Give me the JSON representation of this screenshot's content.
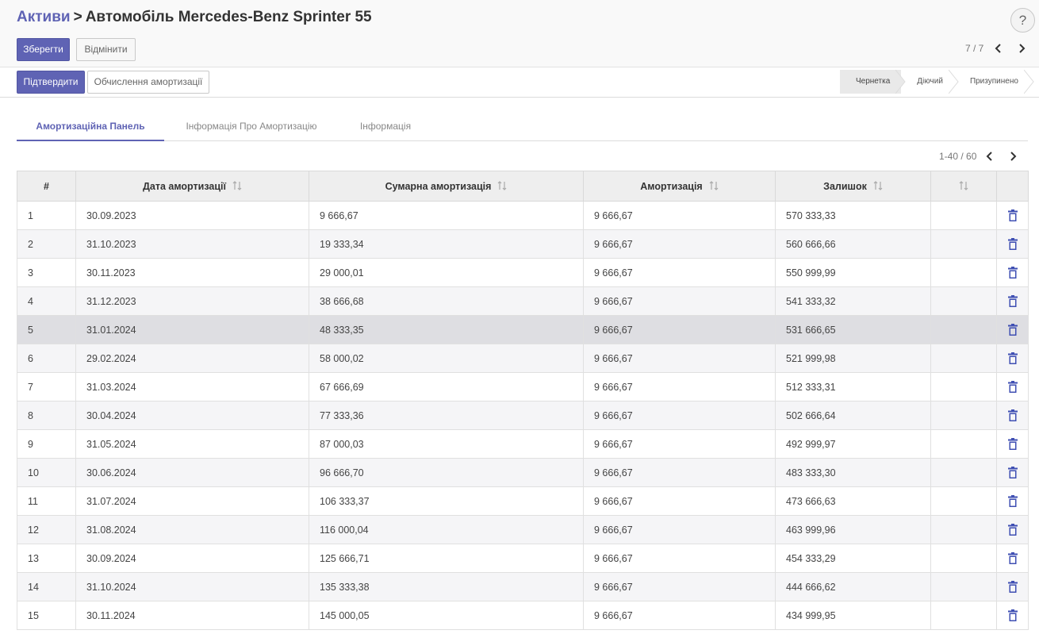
{
  "breadcrumb": {
    "parent": "Активи",
    "separator": ">",
    "current": "Автомобіль Mercedes-Benz Sprinter 55"
  },
  "help": {
    "label": "?"
  },
  "toolbar": {
    "save_label": "Зберегти",
    "discard_label": "Відмінити",
    "pager": "7 / 7"
  },
  "actions": {
    "confirm_label": "Підтвердити",
    "compute_label": "Обчислення амортизації"
  },
  "stages": [
    {
      "label": "Чернетка",
      "active": true
    },
    {
      "label": "Діючий",
      "active": false
    },
    {
      "label": "Призупинено",
      "active": false
    }
  ],
  "tabs": [
    {
      "label": "Амортизаційна Панель",
      "active": true
    },
    {
      "label": "Інформація Про Амортизацію",
      "active": false
    },
    {
      "label": "Інформація",
      "active": false
    }
  ],
  "list_pager": "1-40 / 60",
  "table": {
    "columns": [
      "#",
      "Дата амортизації",
      "Сумарна амортизація",
      "Амортизація",
      "Залишок",
      ""
    ],
    "rows": [
      [
        "1",
        "30.09.2023",
        "9 666,67",
        "9 666,67",
        "570 333,33"
      ],
      [
        "2",
        "31.10.2023",
        "19 333,34",
        "9 666,67",
        "560 666,66"
      ],
      [
        "3",
        "30.11.2023",
        "29 000,01",
        "9 666,67",
        "550 999,99"
      ],
      [
        "4",
        "31.12.2023",
        "38 666,68",
        "9 666,67",
        "541 333,32"
      ],
      [
        "5",
        "31.01.2024",
        "48 333,35",
        "9 666,67",
        "531 666,65"
      ],
      [
        "6",
        "29.02.2024",
        "58 000,02",
        "9 666,67",
        "521 999,98"
      ],
      [
        "7",
        "31.03.2024",
        "67 666,69",
        "9 666,67",
        "512 333,31"
      ],
      [
        "8",
        "30.04.2024",
        "77 333,36",
        "9 666,67",
        "502 666,64"
      ],
      [
        "9",
        "31.05.2024",
        "87 000,03",
        "9 666,67",
        "492 999,97"
      ],
      [
        "10",
        "30.06.2024",
        "96 666,70",
        "9 666,67",
        "483 333,30"
      ],
      [
        "11",
        "31.07.2024",
        "106 333,37",
        "9 666,67",
        "473 666,63"
      ],
      [
        "12",
        "31.08.2024",
        "116 000,04",
        "9 666,67",
        "463 999,96"
      ],
      [
        "13",
        "30.09.2024",
        "125 666,71",
        "9 666,67",
        "454 333,29"
      ],
      [
        "14",
        "31.10.2024",
        "135 333,38",
        "9 666,67",
        "444 666,62"
      ],
      [
        "15",
        "30.11.2024",
        "145 000,05",
        "9 666,67",
        "434 999,95"
      ]
    ],
    "hovered_row": 4
  },
  "colors": {
    "accent": "#5f63b4",
    "delete_icon": "#3f4fb3"
  },
  "icons": {
    "sort": "sort-arrows-icon",
    "delete": "trash-icon",
    "prev": "chevron-left-icon",
    "next": "chevron-right-icon"
  }
}
